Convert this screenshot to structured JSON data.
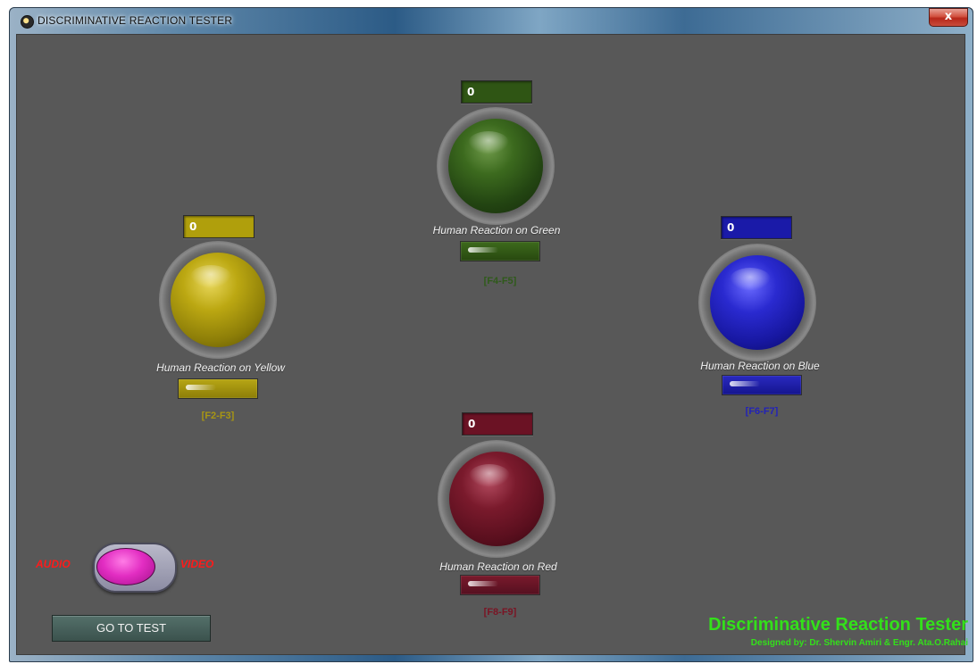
{
  "window": {
    "title": "DISCRIMINATIVE REACTION TESTER",
    "close_label": "x"
  },
  "lights": {
    "green": {
      "count": "0",
      "label": "Human Reaction on Green",
      "keys": "[F4-F5]",
      "color": "#2f5514"
    },
    "yellow": {
      "count": "0",
      "label": "Human Reaction on Yellow",
      "keys": "[F2-F3]",
      "color": "#b09f0c"
    },
    "blue": {
      "count": "0",
      "label": "Human Reaction on Blue",
      "keys": "[F6-F7]",
      "color": "#1a1aa8"
    },
    "red": {
      "count": "0",
      "label": "Human Reaction on Red",
      "keys": "[F8-F9]",
      "color": "#6b1224"
    }
  },
  "mode_toggle": {
    "left_label": "AUDIO",
    "right_label": "VIDEO",
    "state": "AUDIO"
  },
  "go_button_label": "GO TO TEST",
  "footer": {
    "title": "Discriminative Reaction Tester",
    "credit": "Designed by: Dr. Shervin Amiri & Engr. Ata.O.Rahai"
  }
}
